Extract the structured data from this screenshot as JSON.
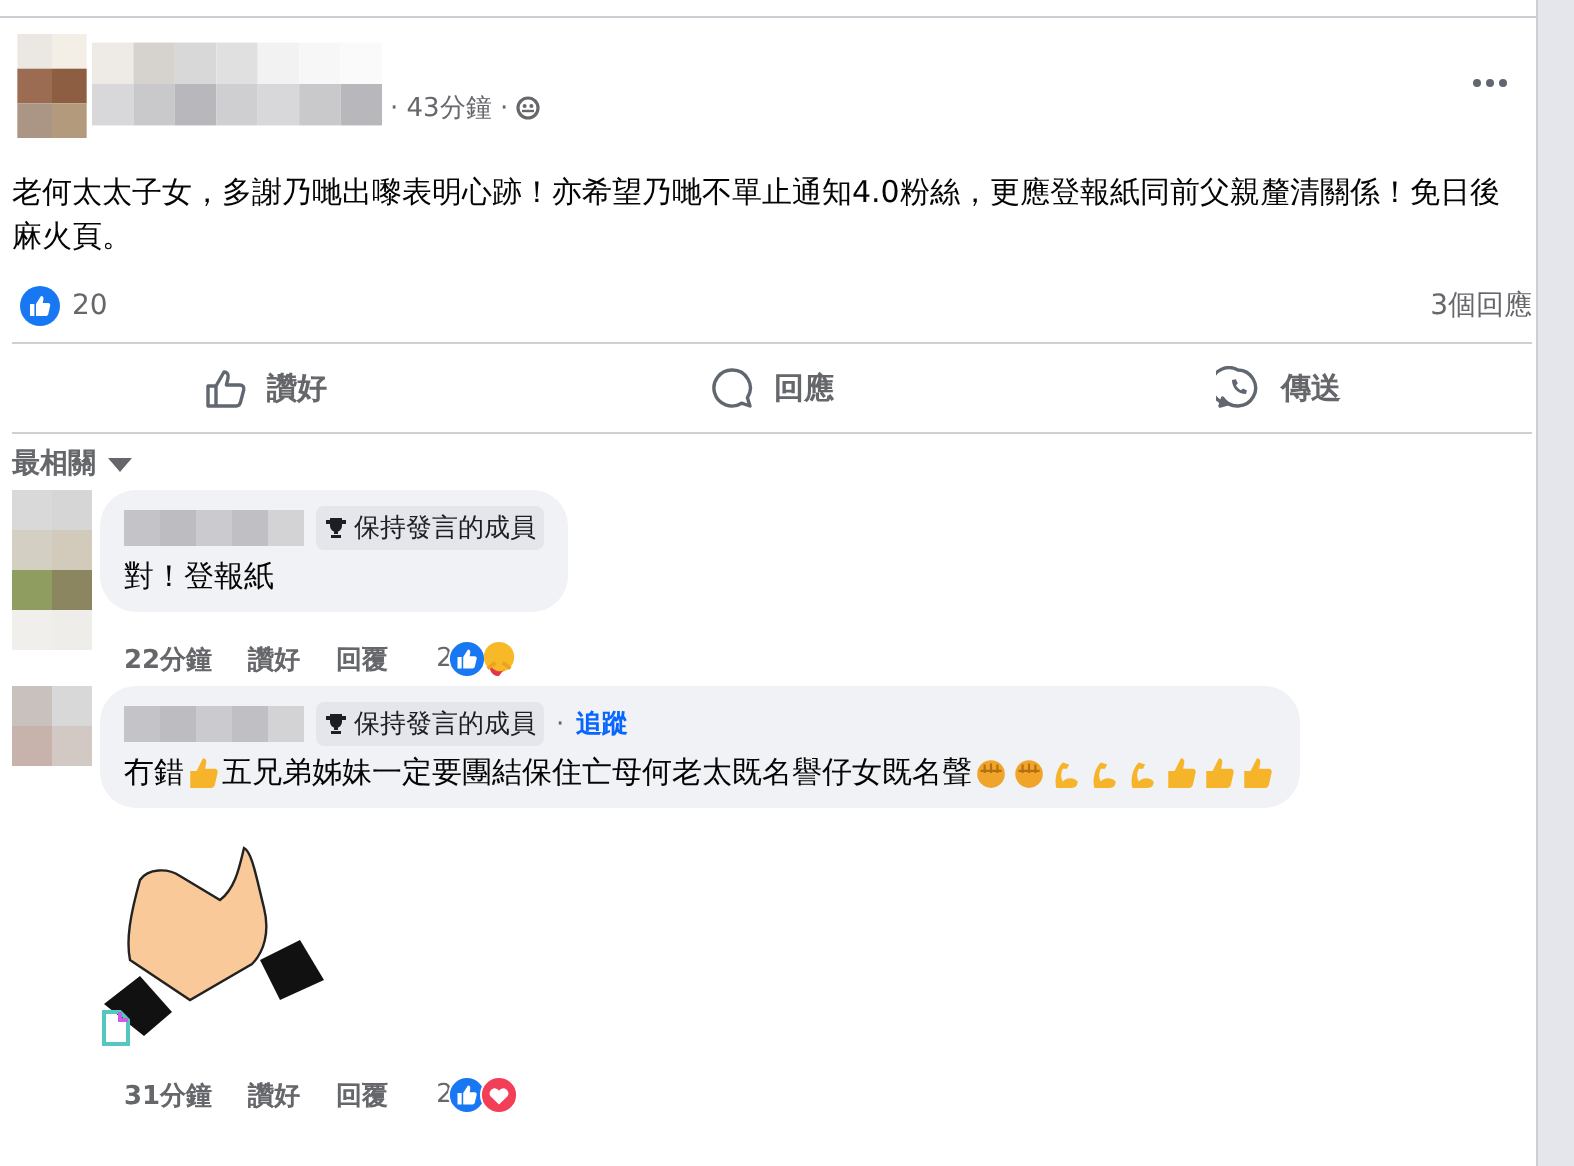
{
  "post": {
    "time": "· 43分鐘 ·",
    "text": "老何太太子女，多謝乃哋出嚟表明心跡！亦希望乃哋不單止通知4.0粉絲，更應登報紙同前父親釐清關係！免日後麻火頁。",
    "like_count": "20",
    "comment_count": "3個回應"
  },
  "actions": [
    {
      "kind": "like",
      "label": "讚好"
    },
    {
      "kind": "comment",
      "label": "回應"
    },
    {
      "kind": "share",
      "label": "傳送"
    }
  ],
  "sort": {
    "label": "最相關"
  },
  "comments": [
    {
      "badge": "保持發言的成員",
      "segments": [
        {
          "kind": "text",
          "text": "對！登報紙"
        }
      ],
      "time": "22分鐘",
      "like": "讚好",
      "reply": "回覆",
      "reaction_count": "2",
      "reactions": [
        {
          "kind": "like"
        },
        {
          "kind": "care"
        }
      ]
    },
    {
      "badge": "保持發言的成員",
      "separator": "·",
      "follow": "追蹤",
      "segments": [
        {
          "kind": "text",
          "text": "冇錯"
        },
        {
          "kind": "thumb"
        },
        {
          "kind": "text",
          "text": "五兄弟姊妹一定要團結保住亡母何老太既名譽仔女既名聲"
        },
        {
          "kind": "fist"
        },
        {
          "kind": "fist"
        },
        {
          "kind": "muscle"
        },
        {
          "kind": "muscle"
        },
        {
          "kind": "muscle"
        },
        {
          "kind": "thumb"
        },
        {
          "kind": "thumb"
        },
        {
          "kind": "thumb"
        }
      ],
      "sticker": {
        "kind": "picture"
      },
      "time": "31分鐘",
      "like": "讚好",
      "reply": "回覆",
      "reaction_count": "2",
      "reactions": [
        {
          "kind": "like"
        },
        {
          "kind": "love"
        }
      ]
    }
  ]
}
